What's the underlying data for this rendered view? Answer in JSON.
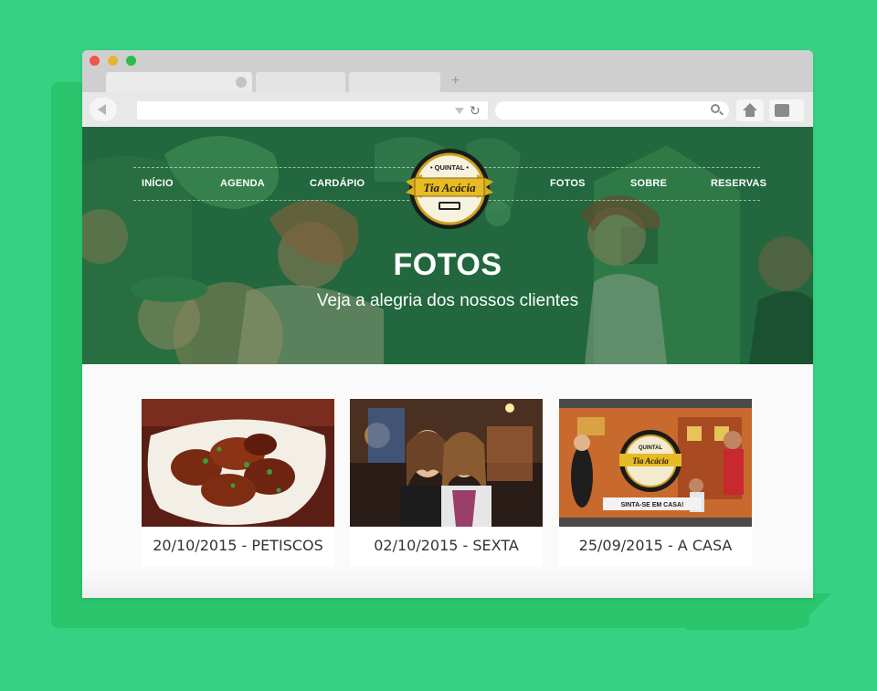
{
  "browser": {
    "new_tab_label": "+",
    "reload_glyph": "↻"
  },
  "nav": {
    "left": [
      "INÍCIO",
      "AGENDA",
      "CARDÁPIO"
    ],
    "right": [
      "FOTOS",
      "SOBRE",
      "RESERVAS"
    ]
  },
  "logo": {
    "top_text": "• QUINTAL •",
    "main_text": "Tia Acácia"
  },
  "hero": {
    "title": "FOTOS",
    "subtitle": "Veja a alegria dos nossos clientes"
  },
  "gallery": [
    {
      "caption": "20/10/2015 - PETISCOS"
    },
    {
      "caption": "02/10/2015 - SEXTA"
    },
    {
      "caption": "25/09/2015 - A CASA"
    }
  ],
  "photo3_sign": {
    "top": "QUINTAL",
    "main": "Tia Acácia",
    "banner": "SINTA-SE EM CASA!"
  },
  "colors": {
    "page_bg": "#35d283",
    "hero_green": "#2c7a47"
  }
}
